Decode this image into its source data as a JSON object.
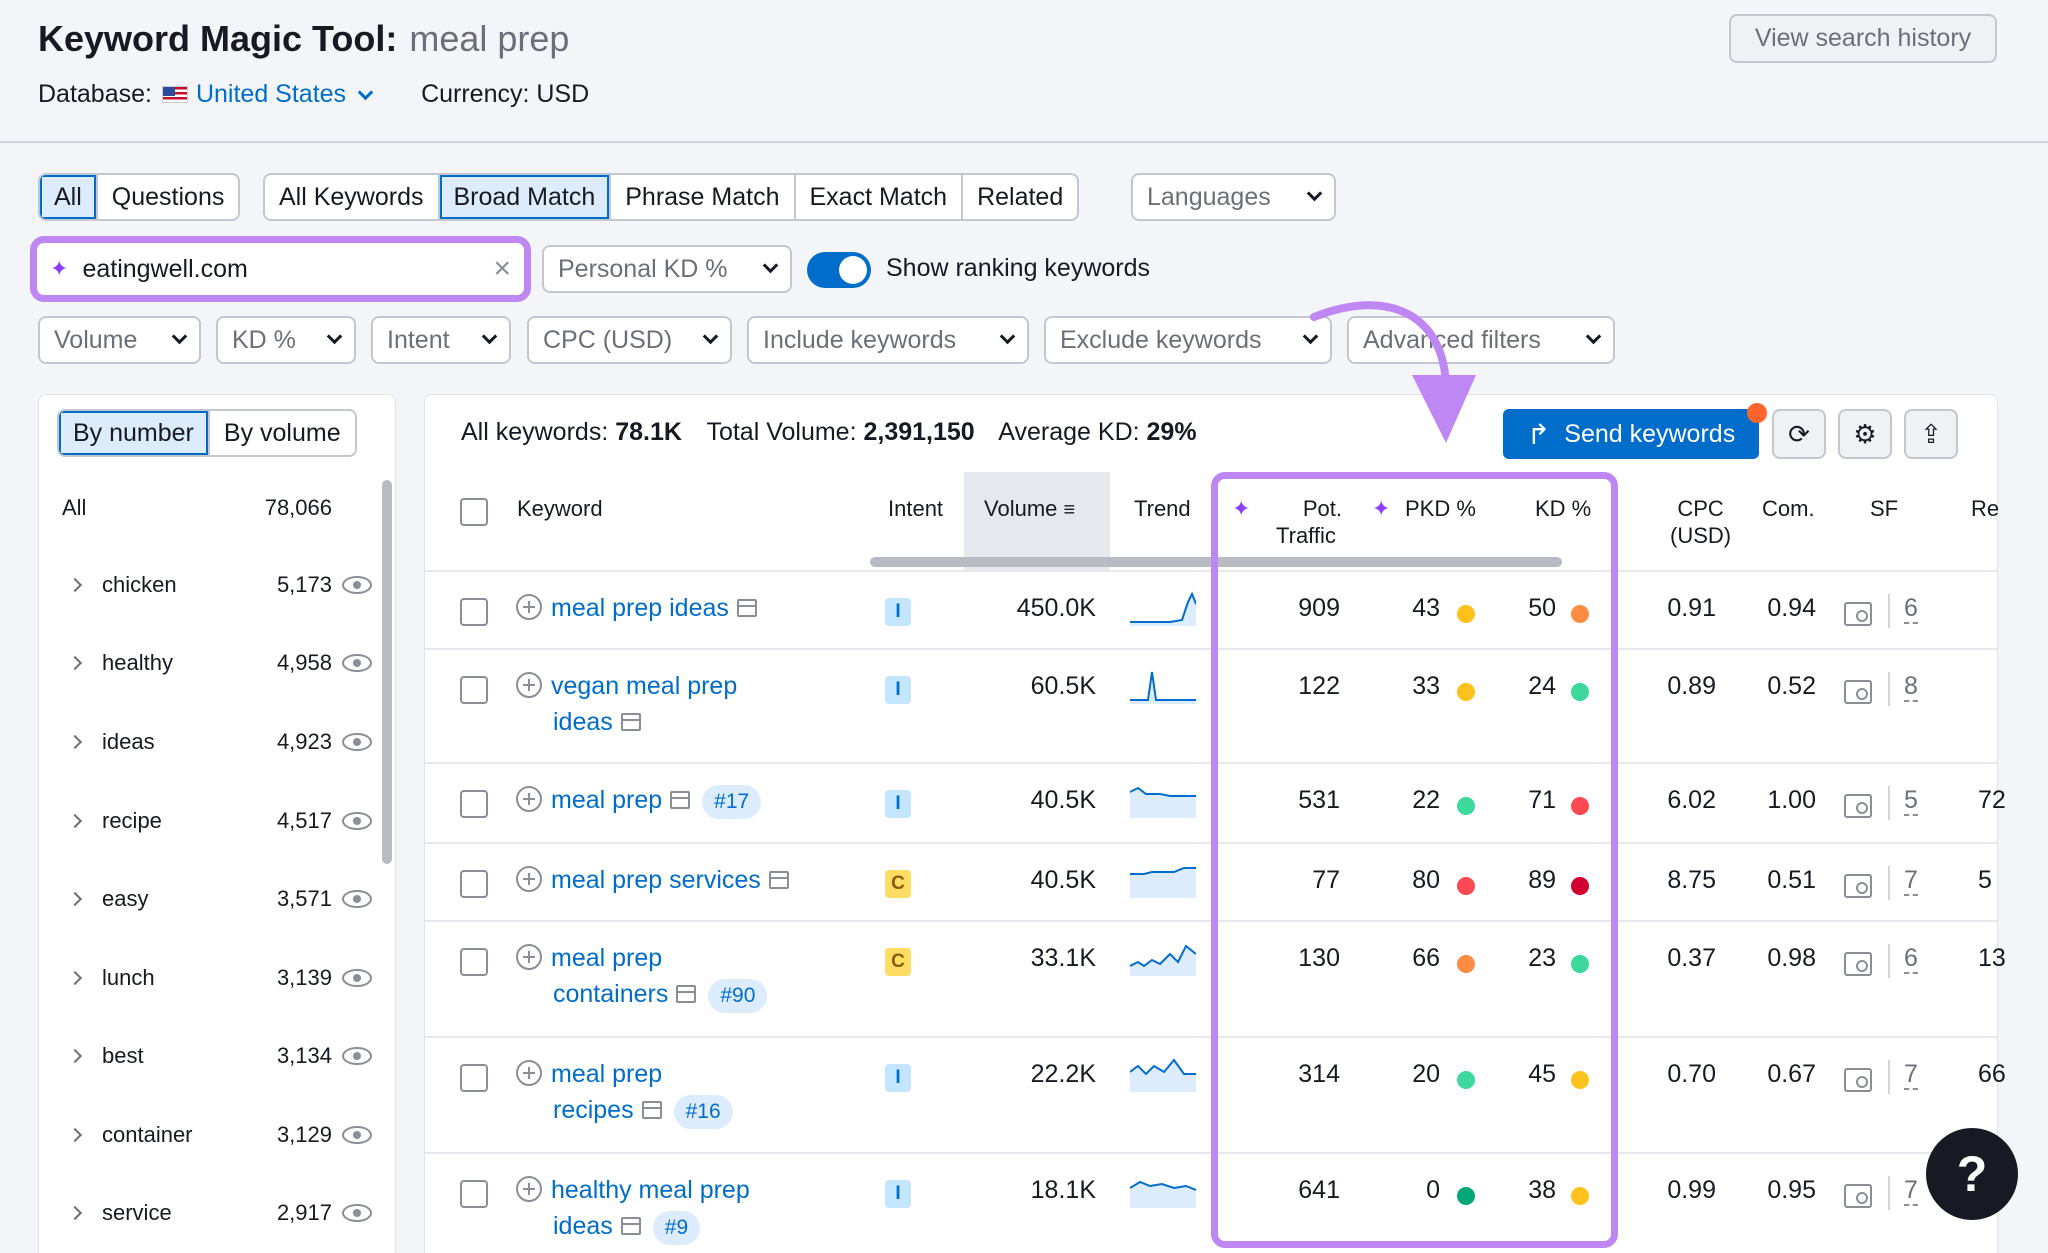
{
  "header": {
    "title": "Keyword Magic Tool:",
    "query": "meal prep",
    "database_label": "Database:",
    "database_value": "United States",
    "currency": "Currency: USD",
    "view_history": "View search history"
  },
  "tabs_mode": [
    "All",
    "Questions"
  ],
  "tabs_match": [
    "All Keywords",
    "Broad Match",
    "Phrase Match",
    "Exact Match",
    "Related"
  ],
  "languages": "Languages",
  "search": {
    "value": "eatingwell.com",
    "clear": "×"
  },
  "personal_kd": "Personal KD %",
  "show_ranking": "Show ranking keywords",
  "filters": [
    "Volume",
    "KD %",
    "Intent",
    "CPC (USD)",
    "Include keywords",
    "Exclude keywords",
    "Advanced filters"
  ],
  "groups": {
    "by_number": "By number",
    "by_volume": "By volume",
    "all_label": "All",
    "all_count": "78,066",
    "items": [
      {
        "label": "chicken",
        "count": "5,173"
      },
      {
        "label": "healthy",
        "count": "4,958"
      },
      {
        "label": "ideas",
        "count": "4,923"
      },
      {
        "label": "recipe",
        "count": "4,517"
      },
      {
        "label": "easy",
        "count": "3,571"
      },
      {
        "label": "lunch",
        "count": "3,139"
      },
      {
        "label": "best",
        "count": "3,134"
      },
      {
        "label": "container",
        "count": "3,129"
      },
      {
        "label": "service",
        "count": "2,917"
      }
    ]
  },
  "summary": {
    "all_keywords_label": "All keywords:",
    "all_keywords": "78.1K",
    "total_volume_label": "Total Volume:",
    "total_volume": "2,391,150",
    "avg_kd_label": "Average KD:",
    "avg_kd": "29%"
  },
  "send_keywords": "Send keywords",
  "columns": {
    "keyword": "Keyword",
    "intent": "Intent",
    "volume": "Volume",
    "trend": "Trend",
    "pot_traffic_1": "Pot.",
    "pot_traffic_2": "Traffic",
    "pkd": "PKD %",
    "kd": "KD %",
    "cpc_1": "CPC",
    "cpc_2": "(USD)",
    "com": "Com.",
    "sf": "SF",
    "re": "Re"
  },
  "rows": [
    {
      "kw1": "meal prep ideas",
      "kw2": "",
      "rank": "",
      "intent": "I",
      "volume": "450.0K",
      "pot": "909",
      "pkd": "43",
      "pkd_color": "#ffc21c",
      "kd": "50",
      "kd_color": "#ff8c43",
      "cpc": "0.91",
      "com": "0.94",
      "sf": "6",
      "re": ""
    },
    {
      "kw1": "vegan meal prep",
      "kw2": "ideas",
      "rank": "",
      "intent": "I",
      "volume": "60.5K",
      "pot": "122",
      "pkd": "33",
      "pkd_color": "#ffc21c",
      "kd": "24",
      "kd_color": "#3cd89c",
      "cpc": "0.89",
      "com": "0.52",
      "sf": "8",
      "re": ""
    },
    {
      "kw1": "meal prep",
      "kw2": "",
      "rank": "#17",
      "intent": "I",
      "volume": "40.5K",
      "pot": "531",
      "pkd": "22",
      "pkd_color": "#3cd89c",
      "kd": "71",
      "kd_color": "#ff4953",
      "cpc": "6.02",
      "com": "1.00",
      "sf": "5",
      "re": "72"
    },
    {
      "kw1": "meal prep services",
      "kw2": "",
      "rank": "",
      "intent": "C",
      "volume": "40.5K",
      "pot": "77",
      "pkd": "80",
      "pkd_color": "#ff4953",
      "kd": "89",
      "kd_color": "#d1002f",
      "cpc": "8.75",
      "com": "0.51",
      "sf": "7",
      "re": "5"
    },
    {
      "kw1": "meal prep",
      "kw2": "containers",
      "rank": "#90",
      "intent": "C",
      "volume": "33.1K",
      "pot": "130",
      "pkd": "66",
      "pkd_color": "#ff8c43",
      "kd": "23",
      "kd_color": "#3cd89c",
      "cpc": "0.37",
      "com": "0.98",
      "sf": "6",
      "re": "13"
    },
    {
      "kw1": "meal prep",
      "kw2": "recipes",
      "rank": "#16",
      "intent": "I",
      "volume": "22.2K",
      "pot": "314",
      "pkd": "20",
      "pkd_color": "#3cd89c",
      "kd": "45",
      "kd_color": "#ffc21c",
      "cpc": "0.70",
      "com": "0.67",
      "sf": "7",
      "re": "66"
    },
    {
      "kw1": "healthy meal prep",
      "kw2": "ideas",
      "rank": "#9",
      "intent": "I",
      "volume": "18.1K",
      "pot": "641",
      "pkd": "0",
      "pkd_color": "#00a878",
      "kd": "38",
      "kd_color": "#ffc21c",
      "cpc": "0.99",
      "com": "0.95",
      "sf": "7",
      "re": ""
    }
  ],
  "help": "?"
}
